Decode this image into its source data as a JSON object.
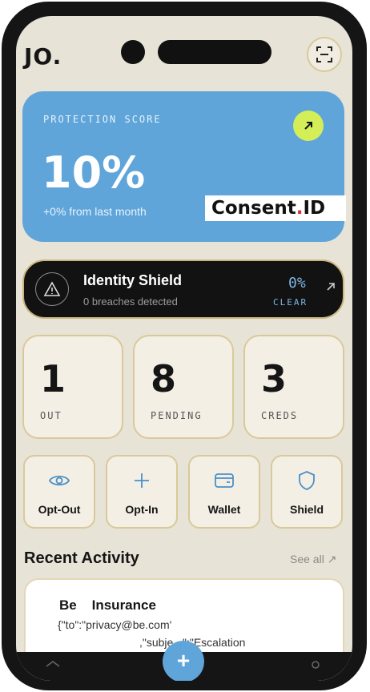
{
  "app": {
    "logo": "JO."
  },
  "score": {
    "label": "PROTECTION SCORE",
    "value": "10%",
    "change": "+0% from last month"
  },
  "brand": {
    "name_a": "Consent",
    "name_b": ".",
    "name_c": "ID"
  },
  "identity_shield": {
    "title": "Identity Shield",
    "subtitle": "0 breaches detected",
    "percent": "0%",
    "status": "CLEAR"
  },
  "stats": [
    {
      "value": "1",
      "label": "OUT"
    },
    {
      "value": "8",
      "label": "PENDING"
    },
    {
      "value": "3",
      "label": "CREDS"
    }
  ],
  "actions": [
    {
      "label": "Opt-Out",
      "icon": "eye-icon"
    },
    {
      "label": "Opt-In",
      "icon": "plus-icon"
    },
    {
      "label": "Wallet",
      "icon": "wallet-icon"
    },
    {
      "label": "Shield",
      "icon": "shield-icon"
    }
  ],
  "recent": {
    "title": "Recent Activity",
    "see_all": "See all ↗",
    "items": [
      {
        "name": "Be    Insurance",
        "line1": "{\"to\":\"privacy@be.com'",
        "line2": ",\"subje   \":\"Escalation"
      }
    ]
  },
  "nav": {
    "fab": "+"
  },
  "colors": {
    "accent": "#5fa5da",
    "lime": "#d4ee58",
    "gold_border": "#d9c99a",
    "background": "#e8e3d7"
  }
}
